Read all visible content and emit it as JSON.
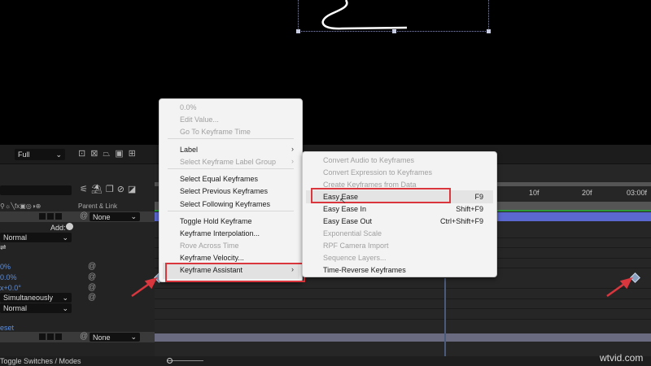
{
  "viewer": {
    "toolbar": {
      "resolution": "Full"
    }
  },
  "layer_panel": {
    "column_header": "Parent & Link",
    "layer1_parent": "None",
    "add_label": "Add:",
    "blend_mode": "Normal",
    "prop_values": [
      "0%",
      "0.0%",
      "x+0.0°"
    ],
    "order_mode": "Simultaneously",
    "blend_mode_2": "Normal",
    "reset_link": "eset",
    "layer2_parent": "None",
    "toggle_label": "Toggle Switches / Modes"
  },
  "timeline": {
    "ruler_labels": [
      "10f",
      "20f",
      "03:00f"
    ],
    "layer_bar_color": "#5b68d0"
  },
  "context_menu": {
    "items": [
      {
        "label": "0.0%",
        "disabled": true
      },
      {
        "label": "Edit Value...",
        "disabled": true
      },
      {
        "label": "Go To Keyframe Time",
        "disabled": true
      },
      {
        "label": "Label",
        "submenu": true
      },
      {
        "label": "Select Keyframe Label Group",
        "disabled": true,
        "submenu": true
      },
      {
        "label": "Select Equal Keyframes"
      },
      {
        "label": "Select Previous Keyframes"
      },
      {
        "label": "Select Following Keyframes"
      },
      {
        "label": "Toggle Hold Keyframe"
      },
      {
        "label": "Keyframe Interpolation..."
      },
      {
        "label": "Rove Across Time",
        "disabled": true
      },
      {
        "label": "Keyframe Velocity..."
      },
      {
        "label": "Keyframe Assistant",
        "submenu": true,
        "highlighted": true
      }
    ],
    "submenu_arrow": "›"
  },
  "submenu": {
    "items": [
      {
        "label": "Convert Audio to Keyframes",
        "disabled": true
      },
      {
        "label": "Convert Expression to Keyframes",
        "disabled": true
      },
      {
        "label": "Create Keyframes from Data",
        "disabled": true
      },
      {
        "label": "Easy Ease",
        "shortcut": "F9",
        "highlighted": true
      },
      {
        "label": "Easy Ease In",
        "shortcut": "Shift+F9"
      },
      {
        "label": "Easy Ease Out",
        "shortcut": "Ctrl+Shift+F9"
      },
      {
        "label": "Exponential Scale",
        "disabled": true
      },
      {
        "label": "RPF Camera Import",
        "disabled": true
      },
      {
        "label": "Sequence Layers...",
        "disabled": true
      },
      {
        "label": "Time-Reverse Keyframes"
      }
    ]
  },
  "annotation_color": "#d9363e",
  "watermark": "wtvid.com"
}
